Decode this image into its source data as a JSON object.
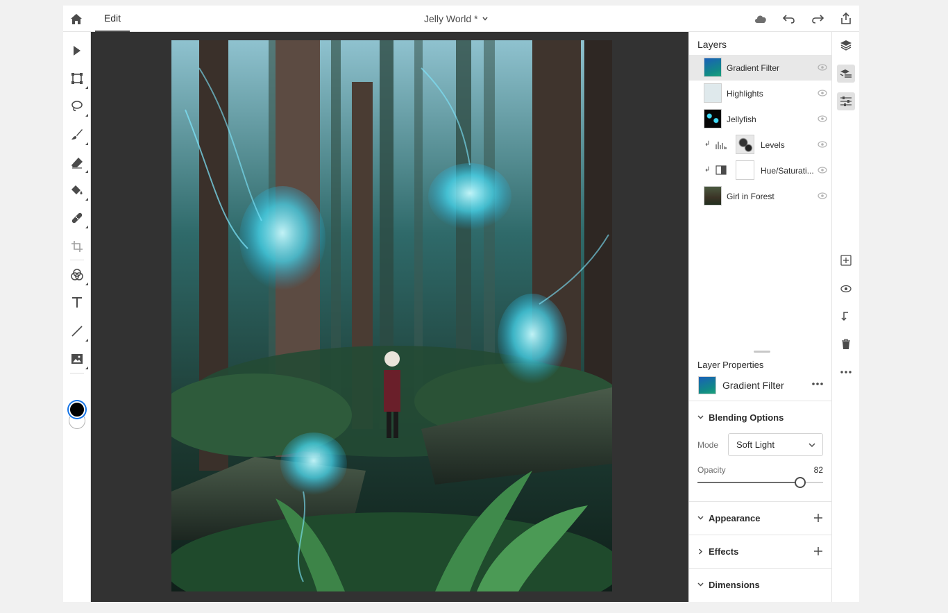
{
  "topbar": {
    "edit_tab": "Edit",
    "document_title": "Jelly World *"
  },
  "toolbar": {
    "tools": [
      "select-tool",
      "transform-tool",
      "lasso-tool",
      "brush-tool",
      "eraser-tool",
      "fill-tool",
      "healing-tool",
      "crop-tool",
      "adjustments-tool",
      "type-tool",
      "line-tool",
      "image-tool"
    ],
    "foreground_color": "#000000",
    "background_color": "#ffffff"
  },
  "layers": {
    "title": "Layers",
    "items": [
      {
        "name": "Gradient Filter",
        "selected": true
      },
      {
        "name": "Highlights"
      },
      {
        "name": "Jellyfish"
      },
      {
        "name": "Levels",
        "type": "adjustment",
        "clipped": true
      },
      {
        "name": "Hue/Saturati...",
        "type": "adjustment",
        "clipped": true
      },
      {
        "name": "Girl in Forest"
      }
    ]
  },
  "properties": {
    "title": "Layer Properties",
    "layer_name": "Gradient Filter",
    "sections": {
      "blending": "Blending Options",
      "appearance": "Appearance",
      "effects": "Effects",
      "dimensions": "Dimensions"
    },
    "mode_label": "Mode",
    "mode_value": "Soft Light",
    "opacity_label": "Opacity",
    "opacity_value": "82"
  },
  "colors": {
    "accent": "#1473e6",
    "canvas_bg": "#323232",
    "selected_row": "#e8e8e8"
  }
}
